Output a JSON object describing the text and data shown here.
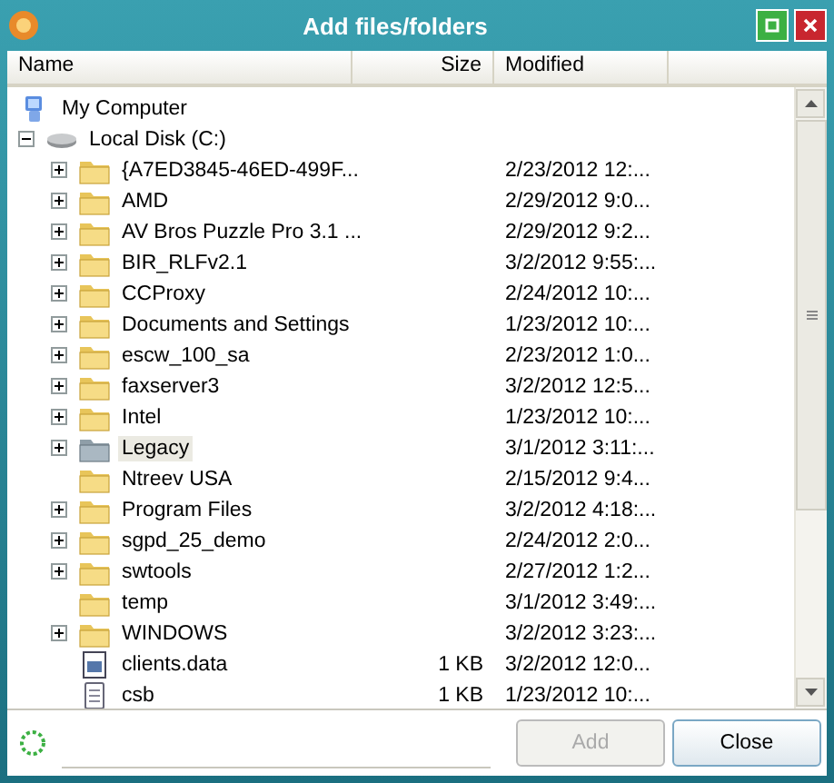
{
  "window": {
    "title": "Add files/folders"
  },
  "columns": [
    {
      "label": "Name"
    },
    {
      "label": "Size"
    },
    {
      "label": "Modified"
    }
  ],
  "tree": [
    {
      "name": "My Computer",
      "kind": "computer",
      "children": [
        {
          "name": "Local Disk (C:)",
          "kind": "drive",
          "has_children": true,
          "expanded": true,
          "selected": false,
          "children": [
            {
              "name": "{A7ED3845-46ED-499F...",
              "kind": "folder",
              "has_children": true,
              "expanded": false,
              "selected": false,
              "modified": "2/23/2012 12:..."
            },
            {
              "name": "AMD",
              "kind": "folder",
              "has_children": true,
              "expanded": false,
              "selected": false,
              "modified": "2/29/2012 9:0..."
            },
            {
              "name": "AV Bros Puzzle Pro 3.1 ...",
              "kind": "folder",
              "has_children": true,
              "expanded": false,
              "selected": false,
              "modified": "2/29/2012 9:2..."
            },
            {
              "name": "BIR_RLFv2.1",
              "kind": "folder",
              "has_children": true,
              "expanded": false,
              "selected": false,
              "modified": "3/2/2012 9:55:..."
            },
            {
              "name": "CCProxy",
              "kind": "folder",
              "has_children": true,
              "expanded": false,
              "selected": false,
              "modified": "2/24/2012 10:..."
            },
            {
              "name": "Documents and Settings",
              "kind": "folder",
              "has_children": true,
              "expanded": false,
              "selected": false,
              "modified": "1/23/2012 10:..."
            },
            {
              "name": "escw_100_sa",
              "kind": "folder",
              "has_children": true,
              "expanded": false,
              "selected": false,
              "modified": "2/23/2012 1:0..."
            },
            {
              "name": "faxserver3",
              "kind": "folder",
              "has_children": true,
              "expanded": false,
              "selected": false,
              "modified": "3/2/2012 12:5..."
            },
            {
              "name": "Intel",
              "kind": "folder",
              "has_children": true,
              "expanded": false,
              "selected": false,
              "modified": "1/23/2012 10:..."
            },
            {
              "name": "Legacy",
              "kind": "folder",
              "has_children": true,
              "expanded": false,
              "selected": true,
              "modified": "3/1/2012 3:11:..."
            },
            {
              "name": "Ntreev USA",
              "kind": "folder",
              "has_children": false,
              "selected": false,
              "modified": "2/15/2012 9:4..."
            },
            {
              "name": "Program Files",
              "kind": "folder",
              "has_children": true,
              "expanded": false,
              "selected": false,
              "modified": "3/2/2012 4:18:..."
            },
            {
              "name": "sgpd_25_demo",
              "kind": "folder",
              "has_children": true,
              "expanded": false,
              "selected": false,
              "modified": "2/24/2012 2:0..."
            },
            {
              "name": "swtools",
              "kind": "folder",
              "has_children": true,
              "expanded": false,
              "selected": false,
              "modified": "2/27/2012 1:2..."
            },
            {
              "name": "temp",
              "kind": "folder",
              "has_children": false,
              "selected": false,
              "modified": "3/1/2012 3:49:..."
            },
            {
              "name": "WINDOWS",
              "kind": "folder",
              "has_children": true,
              "expanded": false,
              "selected": false,
              "modified": "3/2/2012 3:23:..."
            },
            {
              "name": "clients.data",
              "kind": "app-file",
              "has_children": false,
              "selected": false,
              "size": "1 KB",
              "modified": "3/2/2012 12:0..."
            },
            {
              "name": "csb",
              "kind": "text-file",
              "has_children": false,
              "selected": false,
              "size": "1 KB",
              "modified": "1/23/2012 10:..."
            }
          ]
        }
      ]
    }
  ],
  "buttons": [
    {
      "label": "Add",
      "disabled": true
    },
    {
      "label": "Close",
      "disabled": false
    }
  ]
}
